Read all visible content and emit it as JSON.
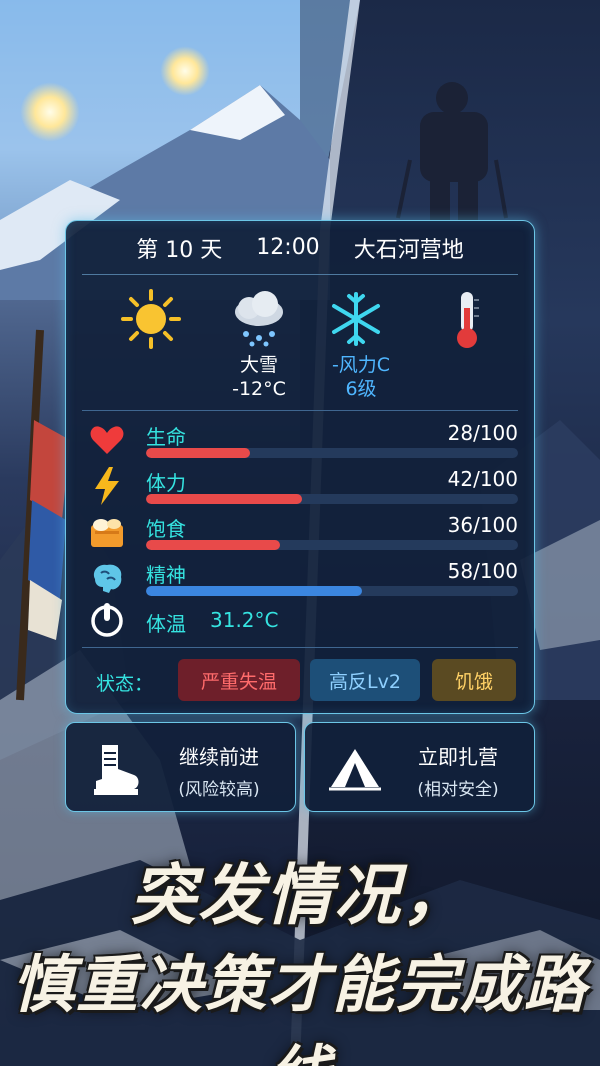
{
  "header": {
    "day": "第 10 天",
    "time": "12:00",
    "location": "大石河营地"
  },
  "weather": {
    "sun_icon": "sun-icon",
    "snow_cloud_icon": "snow-cloud-icon",
    "snowflake_icon": "snowflake-icon",
    "thermometer_icon": "thermometer-icon",
    "condition": "大雪",
    "temperature": "-12°C",
    "wind_label": "-风力C",
    "wind_level": "6级"
  },
  "stats": [
    {
      "icon": "heart-icon",
      "label": "生命",
      "value": "28/100",
      "fraction": 0.28,
      "color": "#e84a4a"
    },
    {
      "icon": "lightning-icon",
      "label": "体力",
      "value": "42/100",
      "fraction": 0.42,
      "color": "#e84a4a"
    },
    {
      "icon": "food-icon",
      "label": "饱食",
      "value": "36/100",
      "fraction": 0.36,
      "color": "#e84a4a"
    },
    {
      "icon": "brain-icon",
      "label": "精神",
      "value": "58/100",
      "fraction": 0.58,
      "color": "#3b86e0"
    }
  ],
  "body_temp": {
    "icon": "power-icon",
    "label": "体温",
    "value": "31.2°C"
  },
  "status": {
    "title": "状态：",
    "badges": [
      {
        "label": "严重失温",
        "bg": "#6e1f2a",
        "fg": "#ff6b6b"
      },
      {
        "label": "高反Lv2",
        "bg": "#1d4f78",
        "fg": "#8fd0ff"
      },
      {
        "label": "饥饿",
        "bg": "#5a4a22",
        "fg": "#ffd166"
      }
    ]
  },
  "actions": {
    "continue": {
      "icon": "boot-icon",
      "label": "继续前进",
      "sub": "(风险较高)"
    },
    "camp": {
      "icon": "tent-icon",
      "label": "立即扎营",
      "sub": "(相对安全)"
    }
  },
  "headline": {
    "line1": "突发情况，",
    "line2": "慎重决策才能完成路线"
  }
}
